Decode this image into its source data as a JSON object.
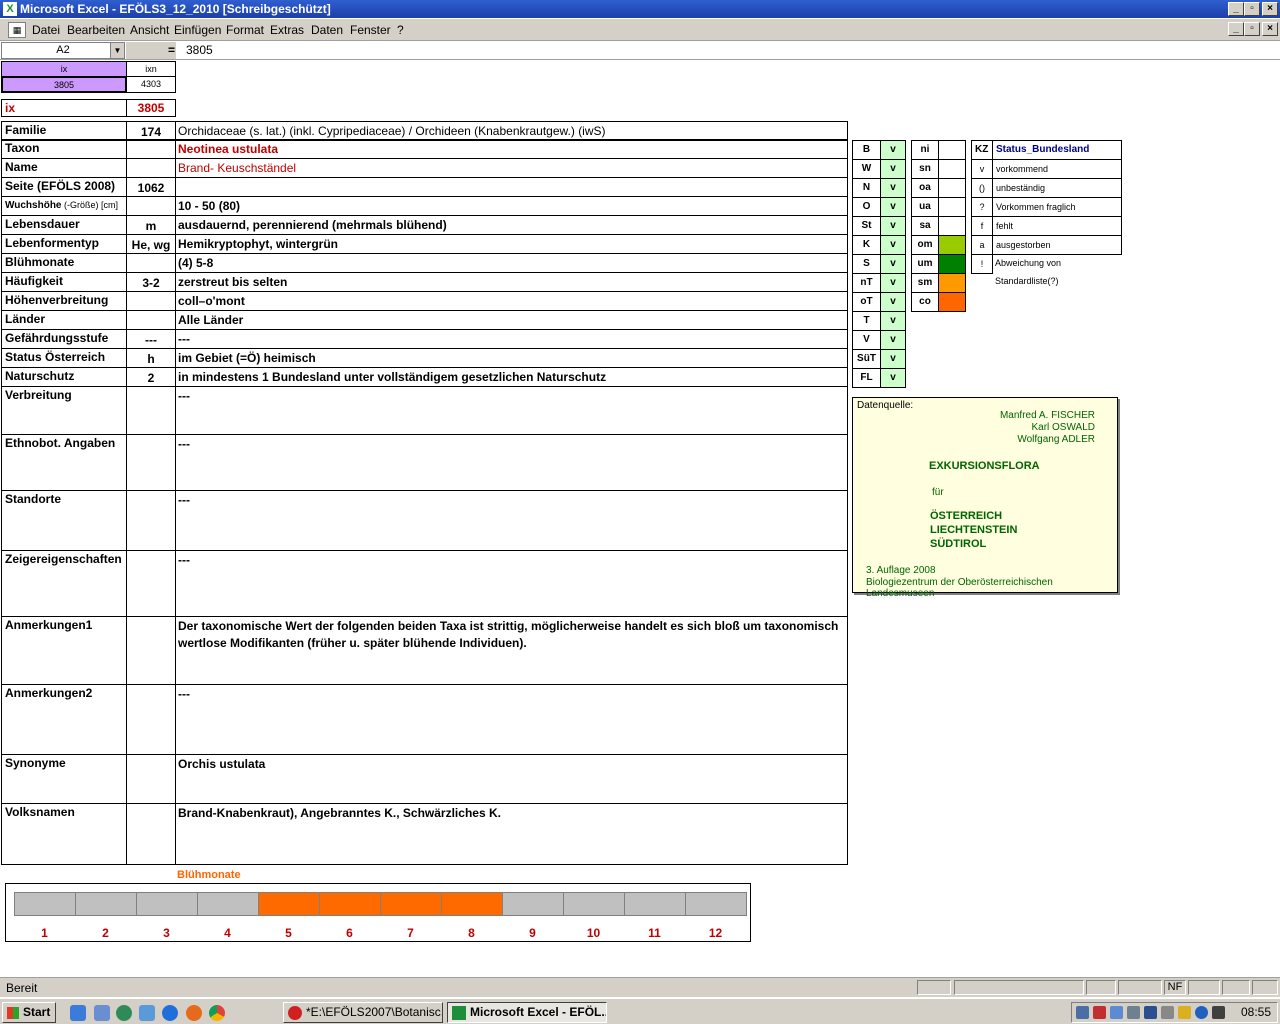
{
  "window": {
    "title": "Microsoft Excel - EFÖLS3_12_2010  [Schreibgeschützt]"
  },
  "menu": [
    "Datei",
    "Bearbeiten",
    "Ansicht",
    "Einfügen",
    "Format",
    "Extras",
    "Daten",
    "Fenster",
    "?"
  ],
  "formula": {
    "cell": "A2",
    "eq": "=",
    "value": "3805"
  },
  "header": {
    "ix_label": "ix",
    "ixn_label": "ixn",
    "ix_value": "3805",
    "ixn_value": "4303"
  },
  "ix": {
    "label": "ix",
    "value": "3805"
  },
  "rows": [
    {
      "label": "Familie",
      "code": "174",
      "value": "Orchidaceae (s. lat.) (inkl. Cypripediaceae)  /  Orchideen (Knabenkrautgew.) (iwS)"
    },
    {
      "label": "Taxon",
      "code": "",
      "value": "Neotinea ustulata"
    },
    {
      "label": "Name",
      "code": "",
      "value": "Brand- Keuschständel"
    },
    {
      "label": "Seite (EFÖLS 2008)",
      "code": "1062",
      "value": ""
    },
    {
      "label": "Wuchshöhe",
      "label_suffix": " (-Größe) [cm]",
      "code": "",
      "value": " 10 - 50 (80)"
    },
    {
      "label": "Lebensdauer",
      "code": "m",
      "value": "ausdauernd, perennierend (mehrmals blühend)"
    },
    {
      "label": "Lebenformentyp",
      "code": "He, wg",
      "value": "Hemikryptophyt, wintergrün"
    },
    {
      "label": "Blühmonate",
      "code": "",
      "value": "(4) 5-8"
    },
    {
      "label": "Häufigkeit",
      "code": "3-2",
      "value": "zerstreut bis selten"
    },
    {
      "label": "Höhenverbreitung",
      "code": "",
      "value": "coll–o'mont"
    },
    {
      "label": "Länder",
      "code": "",
      "value": "Alle Länder"
    },
    {
      "label": "Gefährdungsstufe",
      "code": "---",
      "value": " ---"
    },
    {
      "label": "Status Österreich",
      "code": "h",
      "value": "im Gebiet (=Ö) heimisch"
    },
    {
      "label": "Naturschutz",
      "code": "2",
      "value": "in mindestens 1 Bundesland unter vollständigem gesetzlichen Naturschutz"
    }
  ],
  "tall_rows": [
    {
      "label": "Verbreitung",
      "value": " ---"
    },
    {
      "label": "Ethnobot. Angaben",
      "value": "---"
    },
    {
      "label": "Standorte",
      "value": "---"
    },
    {
      "label": "Zeigereigenschaften",
      "value": "---"
    },
    {
      "label": "Anmerkungen1",
      "value": "Der taxonomische Wert der folgenden beiden Taxa ist strittig, möglicherweise handelt es sich bloß um taxonomisch wertlose Modifikanten (früher u. später blühende Individuen)."
    },
    {
      "label": "Anmerkungen2",
      "value": "---"
    },
    {
      "label": "Synonyme",
      "value": "Orchis ustulata"
    },
    {
      "label": "Volksnamen",
      "value": "Brand-Knabenkraut), Angebranntes K., Schwärzliches K."
    }
  ],
  "states": [
    {
      "abbr": "B",
      "status": "v"
    },
    {
      "abbr": "W",
      "status": "v"
    },
    {
      "abbr": "N",
      "status": "v"
    },
    {
      "abbr": "O",
      "status": "v"
    },
    {
      "abbr": "St",
      "status": "v"
    },
    {
      "abbr": "K",
      "status": "v"
    },
    {
      "abbr": "S",
      "status": "v"
    },
    {
      "abbr": "nT",
      "status": "v"
    },
    {
      "abbr": "oT",
      "status": "v"
    },
    {
      "abbr": "T",
      "status": "v"
    },
    {
      "abbr": "V",
      "status": "v"
    },
    {
      "abbr": "SüT",
      "status": "v"
    },
    {
      "abbr": "FL",
      "status": "v"
    }
  ],
  "zones": [
    {
      "abbr": "ni",
      "color": ""
    },
    {
      "abbr": "sn",
      "color": ""
    },
    {
      "abbr": "oa",
      "color": ""
    },
    {
      "abbr": "ua",
      "color": ""
    },
    {
      "abbr": "sa",
      "color": ""
    },
    {
      "abbr": "om",
      "color": "#99cc00"
    },
    {
      "abbr": "um",
      "color": "#008000"
    },
    {
      "abbr": "sm",
      "color": "#ff9900"
    },
    {
      "abbr": "co",
      "color": "#ff6600"
    }
  ],
  "legend": {
    "kz": "KZ",
    "title": "Status_Bundesland",
    "items": [
      {
        "k": "v",
        "t": "vorkommend"
      },
      {
        "k": "()",
        "t": "unbeständig"
      },
      {
        "k": "?",
        "t": "Vorkommen fraglich"
      },
      {
        "k": "f",
        "t": "fehlt"
      },
      {
        "k": "a",
        "t": "ausgestorben"
      },
      {
        "k": "!",
        "t": "Abweichung von Standardliste(?)"
      }
    ]
  },
  "source": {
    "label": "Datenquelle:",
    "authors": [
      "Manfred A. FISCHER",
      "Karl OSWALD",
      "Wolfgang ADLER"
    ],
    "book": "EXKURSIONSFLORA",
    "fuer": "für",
    "countries": [
      "ÖSTERREICH",
      "LIECHTENSTEIN",
      "SÜDTIROL"
    ],
    "edition": "3. Auflage 2008",
    "publisher": "Biologiezentrum der Oberösterreichischen Landesmuseen"
  },
  "bloom": {
    "title": "Blühmonate",
    "months": [
      "1",
      "2",
      "3",
      "4",
      "5",
      "6",
      "7",
      "8",
      "9",
      "10",
      "11",
      "12"
    ],
    "active": [
      false,
      false,
      false,
      false,
      true,
      true,
      true,
      true,
      false,
      false,
      false,
      false
    ],
    "on_color": "#ff6a00",
    "off_color": "#c0c0c0"
  },
  "status": {
    "text": "Bereit",
    "nf": "NF"
  },
  "taskbar": {
    "start": "Start",
    "tasks": [
      "*E:\\EFÖLS2007\\Botanisc...",
      "Microsoft Excel - EFÖL..."
    ],
    "clock": "08:55"
  }
}
